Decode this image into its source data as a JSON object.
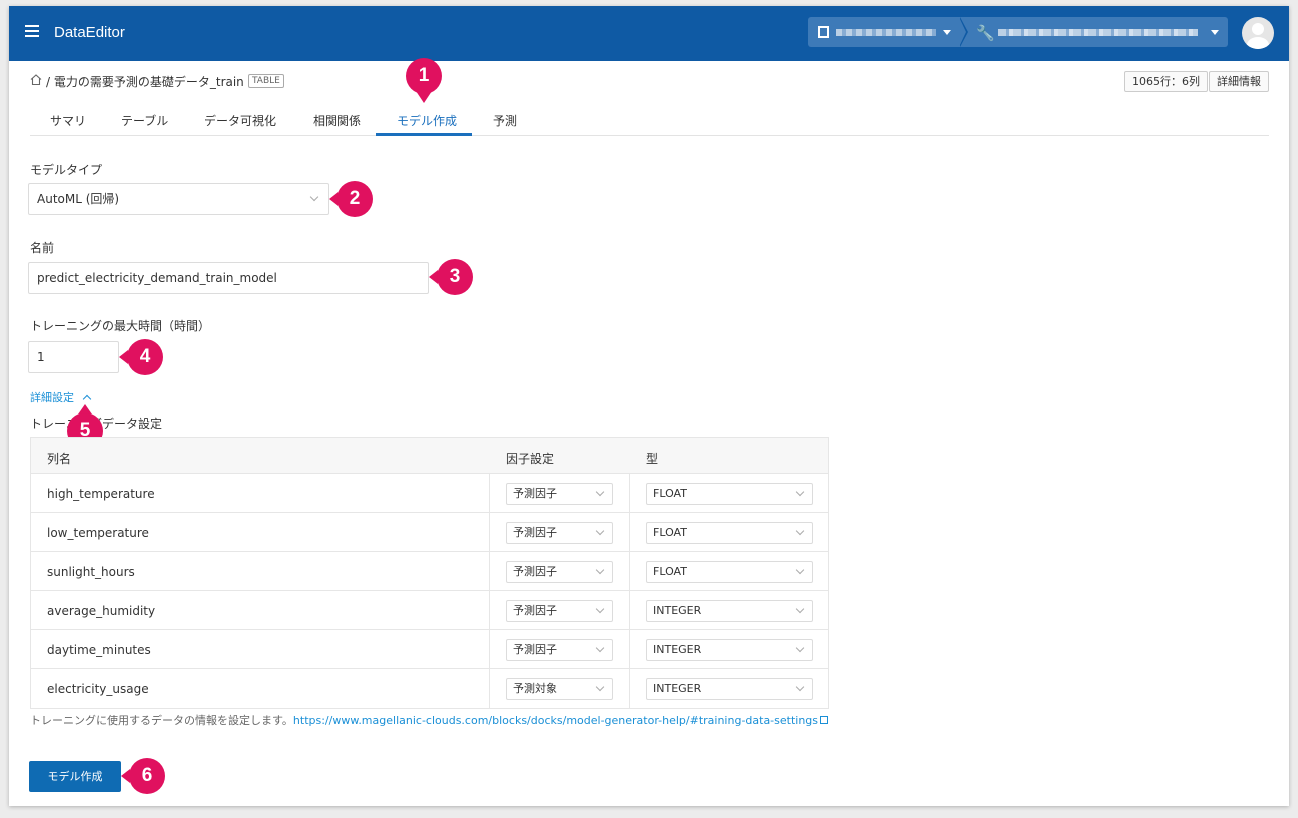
{
  "header": {
    "app_title": "DataEditor",
    "icons": [
      "menu-icon",
      "building-icon",
      "wrench-icon",
      "avatar"
    ]
  },
  "breadcrumb": {
    "path": "/ 電力の需要予測の基礎データ_train",
    "tag": "TABLE"
  },
  "meta": {
    "rows_cols": "1065行：6列",
    "detail_button": "詳細情報"
  },
  "tabs": [
    "サマリ",
    "テーブル",
    "データ可視化",
    "相関関係",
    "モデル作成",
    "予測"
  ],
  "form": {
    "model_type_label": "モデルタイプ",
    "model_type_value": "AutoML (回帰)",
    "name_label": "名前",
    "name_value": "predict_electricity_demand_train_model",
    "max_time_label": "トレーニングの最大時間（時間）",
    "max_time_value": "1",
    "advanced_link": "詳細設定",
    "training_label": "トレーニングデータ設定"
  },
  "table": {
    "headers": [
      "列名",
      "因子設定",
      "型"
    ],
    "rows": [
      {
        "name": "high_temperature",
        "factor": "予測因子",
        "type": "FLOAT"
      },
      {
        "name": "low_temperature",
        "factor": "予測因子",
        "type": "FLOAT"
      },
      {
        "name": "sunlight_hours",
        "factor": "予測因子",
        "type": "FLOAT"
      },
      {
        "name": "average_humidity",
        "factor": "予測因子",
        "type": "INTEGER"
      },
      {
        "name": "daytime_minutes",
        "factor": "予測因子",
        "type": "INTEGER"
      },
      {
        "name": "electricity_usage",
        "factor": "予測対象",
        "type": "INTEGER"
      }
    ]
  },
  "help": {
    "text": "トレーニングに使用するデータの情報を設定します。",
    "url": "https://www.magellanic-clouds.com/blocks/docks/model-generator-help/#training-data-settings"
  },
  "actions": {
    "create_button": "モデル作成"
  },
  "markers": [
    "1",
    "2",
    "3",
    "4",
    "5",
    "6"
  ],
  "colors": {
    "header": "#0f5aa4",
    "accent": "#1a6fbd",
    "marker": "#e0115f",
    "link": "#1a8fd6"
  }
}
